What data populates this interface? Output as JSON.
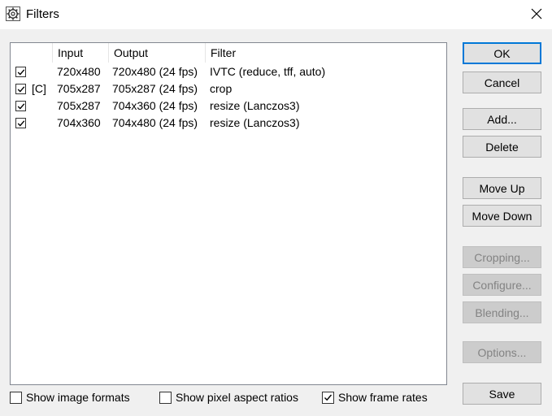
{
  "window": {
    "title": "Filters"
  },
  "table": {
    "columns": [
      "Input",
      "Output",
      "Filter"
    ],
    "rows": [
      {
        "checked": true,
        "tag": "",
        "input": "720x480",
        "output": "720x480 (24 fps)",
        "filter": "IVTC (reduce, tff, auto)"
      },
      {
        "checked": true,
        "tag": "[C]",
        "input": "705x287",
        "output": "705x287 (24 fps)",
        "filter": "crop"
      },
      {
        "checked": true,
        "tag": "",
        "input": "705x287",
        "output": "704x360 (24 fps)",
        "filter": "resize (Lanczos3)"
      },
      {
        "checked": true,
        "tag": "",
        "input": "704x360",
        "output": "704x480 (24 fps)",
        "filter": "resize (Lanczos3)"
      }
    ]
  },
  "buttons": {
    "ok": "OK",
    "cancel": "Cancel",
    "add": "Add...",
    "delete": "Delete",
    "move_up": "Move Up",
    "move_down": "Move Down",
    "cropping": "Cropping...",
    "configure": "Configure...",
    "blending": "Blending...",
    "options": "Options...",
    "save": "Save"
  },
  "options": {
    "show_image_formats": {
      "label": "Show image formats",
      "checked": false
    },
    "show_pixel_aspect_ratios": {
      "label": "Show pixel aspect ratios",
      "checked": false
    },
    "show_frame_rates": {
      "label": "Show frame rates",
      "checked": true
    }
  },
  "colors": {
    "accent": "#0078d7",
    "disabled_text": "#838383"
  },
  "icons": {
    "app": "filters-gear-icon",
    "close": "close-icon",
    "check": "checkmark-icon"
  }
}
